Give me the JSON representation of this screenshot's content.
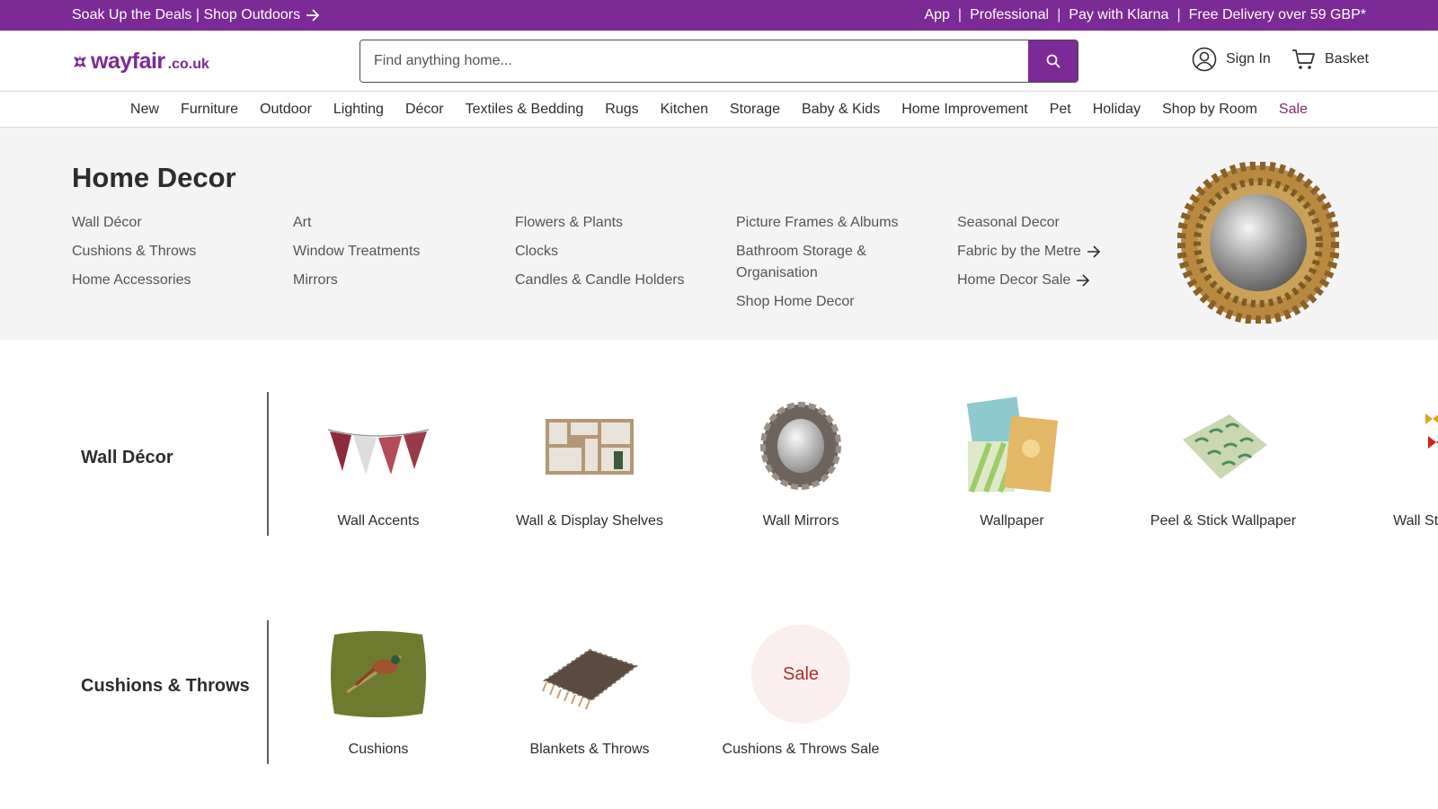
{
  "promo": {
    "left_text": "Soak Up the Deals | Shop Outdoors",
    "right_links": [
      "App",
      "Professional",
      "Pay with Klarna",
      "Free Delivery over 59 GBP*"
    ]
  },
  "header": {
    "logo_word": "wayfair",
    "logo_tld": ".co.uk",
    "search_placeholder": "Find anything home...",
    "sign_in": "Sign In",
    "basket": "Basket"
  },
  "nav": [
    "New",
    "Furniture",
    "Outdoor",
    "Lighting",
    "Décor",
    "Textiles & Bedding",
    "Rugs",
    "Kitchen",
    "Storage",
    "Baby & Kids",
    "Home Improvement",
    "Pet",
    "Holiday",
    "Shop by Room",
    "Sale"
  ],
  "hero": {
    "title": "Home Decor",
    "columns": [
      [
        "Wall Décor",
        "Cushions & Throws",
        "Home Accessories"
      ],
      [
        "Art",
        "Window Treatments",
        "Mirrors"
      ],
      [
        "Flowers & Plants",
        "Clocks",
        "Candles & Candle Holders"
      ],
      [
        "Picture Frames & Albums",
        "Bathroom Storage & Organisation",
        "Shop Home Decor"
      ],
      [
        "Seasonal Decor",
        "Fabric by the Metre",
        "Home Decor Sale"
      ]
    ]
  },
  "rows": [
    {
      "label": "Wall Décor",
      "tiles": [
        "Wall Accents",
        "Wall & Display Shelves",
        "Wall Mirrors",
        "Wallpaper",
        "Peel & Stick Wallpaper",
        "Wall Stickers"
      ]
    },
    {
      "label": "Cushions & Throws",
      "tiles": [
        "Cushions",
        "Blankets & Throws",
        "Cushions & Throws Sale"
      ],
      "sale_badge": "Sale"
    }
  ],
  "colors": {
    "brand": "#7b2a96",
    "sale_text": "#a8322c",
    "hero_bg": "#f4f4f4"
  }
}
